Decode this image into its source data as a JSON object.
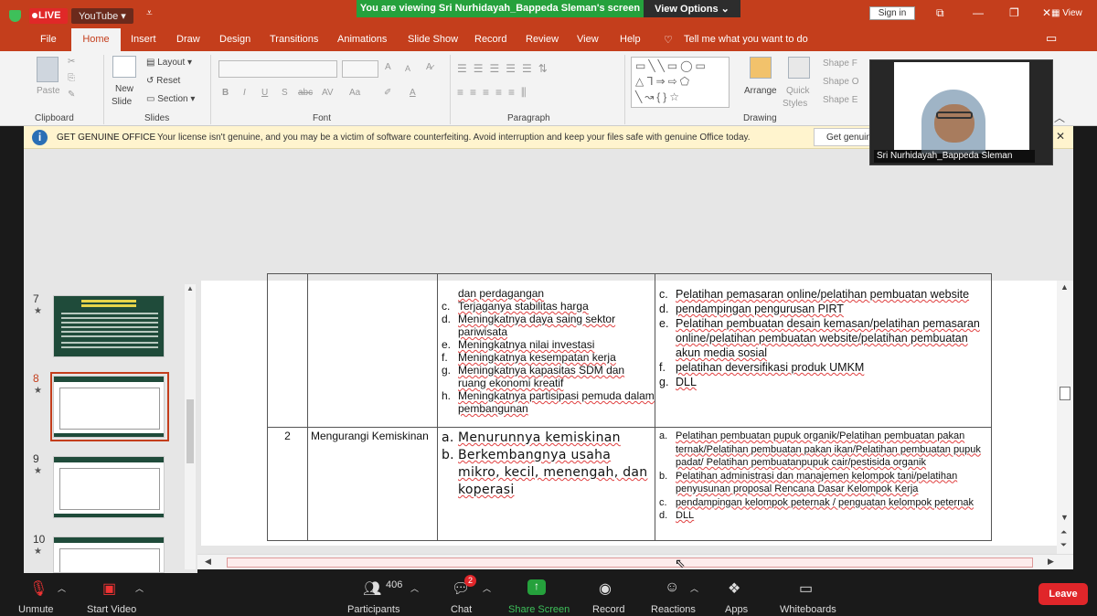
{
  "top_bar": {
    "live": "LIVE",
    "youtube": "YouTube",
    "banner": "You are viewing Sri Nurhidayah_Bappeda Sleman's screen",
    "view_options": "View Options",
    "sign_in": "Sign in",
    "view": "View"
  },
  "ribbon": {
    "tabs": [
      "File",
      "Home",
      "Insert",
      "Draw",
      "Design",
      "Transitions",
      "Animations",
      "Slide Show",
      "Record",
      "Review",
      "View",
      "Help"
    ],
    "active_tab": "Home",
    "tell_me": "Tell me what you want to do",
    "groups": {
      "clipboard": "Clipboard",
      "slides": "Slides",
      "font": "Font",
      "paragraph": "Paragraph",
      "drawing": "Drawing"
    },
    "buttons": {
      "paste": "Paste",
      "new_slide": "New",
      "new_slide_2": "Slide",
      "layout": "Layout",
      "reset": "Reset",
      "section": "Section",
      "arrange": "Arrange",
      "quick_styles": "Quick",
      "quick_styles_2": "Styles",
      "shape_fill": "Shape F",
      "shape_outline": "Shape O",
      "shape_effects": "Shape E",
      "bold": "B",
      "italic": "I",
      "underline": "U",
      "strike": "S",
      "abc": "abc",
      "av": "AV",
      "aa": "Aa",
      "font_grow": "A",
      "font_shrink": "A"
    }
  },
  "notice": {
    "title": "GET GENUINE OFFICE",
    "message": "Your license isn't genuine, and you may be a victim of software counterfeiting. Avoid interruption and keep your files safe with genuine Office today.",
    "button": "Get genuin"
  },
  "webcam": {
    "name": "Sri Nurhidayah_Bappeda Sleman"
  },
  "slides": [
    {
      "num": "7",
      "star": "★"
    },
    {
      "num": "8",
      "star": "★"
    },
    {
      "num": "9",
      "star": "★"
    },
    {
      "num": "10",
      "star": "★"
    }
  ],
  "table": {
    "row1": {
      "left_items": [
        {
          "m": "",
          "t": "dan perdagangan"
        },
        {
          "m": "c.",
          "t": "Terjaganya stabilitas harga"
        },
        {
          "m": "d.",
          "t": "Meningkatnya daya saing sektor pariwisata"
        },
        {
          "m": "e.",
          "t": "Meningkatnya nilai investasi"
        },
        {
          "m": "f.",
          "t": "Meningkatnya kesempatan kerja"
        },
        {
          "m": "g.",
          "t": "Meningkatnya kapasitas SDM dan ruang ekonomi kreatif"
        },
        {
          "m": "h.",
          "t": "Meningkatnya partisipasi pemuda dalam pembangunan"
        }
      ],
      "right_items": [
        {
          "m": "c.",
          "t": "Pelatihan pemasaran online/pelatihan pembuatan website"
        },
        {
          "m": "d.",
          "t": "pendampingan pengurusan PIRT"
        },
        {
          "m": "e.",
          "t": "Pelatihan pembuatan desain kemasan/pelatihan pemasaran online/pelatihan pembuatan website/pelatihan pembuatan akun media  sosial"
        },
        {
          "m": "f.",
          "t": "pelatihan deversifikasi produk UMKM"
        },
        {
          "m": "g.",
          "t": "DLL"
        }
      ]
    },
    "row2": {
      "no": "2",
      "program": "Mengurangi Kemiskinan",
      "left_items": [
        {
          "m": "a.",
          "t": "Menurunnya kemiskinan"
        },
        {
          "m": "b.",
          "t": "Berkembangnya usaha mikro, kecil, menengah, dan koperasi"
        }
      ],
      "right_items": [
        {
          "m": "a.",
          "t": "Pelatihan pembuatan pupuk organik/Pelatihan pembuatan pakan ternak/Pelatihan pembuatan pakan ikan/Pelatihan pembuatan pupuk padat/ Pelatihan pembuatanpupuk cair/pestisida organik"
        },
        {
          "m": "b.",
          "t": "Pelatihan administrasi dan manajemen kelompok tani/pelatihan penyusunan proposal Rencana Dasar Kelompok Kerja"
        },
        {
          "m": "c.",
          "t": "pendampingan kelompok peternak / penguatan kelompok peternak"
        },
        {
          "m": "d.",
          "t": "DLL"
        }
      ]
    }
  },
  "toolbar": {
    "unmute": "Unmute",
    "start_video": "Start Video",
    "participants": "Participants",
    "participants_count": "406",
    "chat": "Chat",
    "chat_badge": "2",
    "share_screen": "Share Screen",
    "record": "Record",
    "reactions": "Reactions",
    "apps": "Apps",
    "whiteboards": "Whiteboards",
    "leave": "Leave"
  }
}
